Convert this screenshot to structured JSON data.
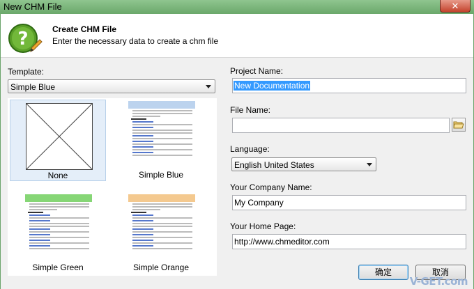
{
  "window": {
    "title": "New CHM File",
    "close_glyph": "✕"
  },
  "header": {
    "title": "Create CHM File",
    "subtitle": "Enter the necessary data to create a chm file",
    "icon": "help-question-icon"
  },
  "template": {
    "label": "Template:",
    "selected": "Simple Blue",
    "items": [
      {
        "name": "None",
        "selected": true
      },
      {
        "name": "Simple Blue",
        "header_color": "#bcd3ee"
      },
      {
        "name": "Simple Green",
        "header_color": "#86d676"
      },
      {
        "name": "Simple Orange",
        "header_color": "#f4c98f"
      }
    ]
  },
  "form": {
    "project_name": {
      "label": "Project Name:",
      "value": "New Documentation"
    },
    "file_name": {
      "label": "File Name:",
      "value": ""
    },
    "language": {
      "label": "Language:",
      "value": "English United States"
    },
    "company": {
      "label": "Your Company Name:",
      "value": "My Company"
    },
    "home_page": {
      "label": "Your Home Page:",
      "value": "http://www.chmeditor.com"
    }
  },
  "buttons": {
    "ok": "确定",
    "cancel": "取消"
  },
  "watermark": "V-GET.com"
}
